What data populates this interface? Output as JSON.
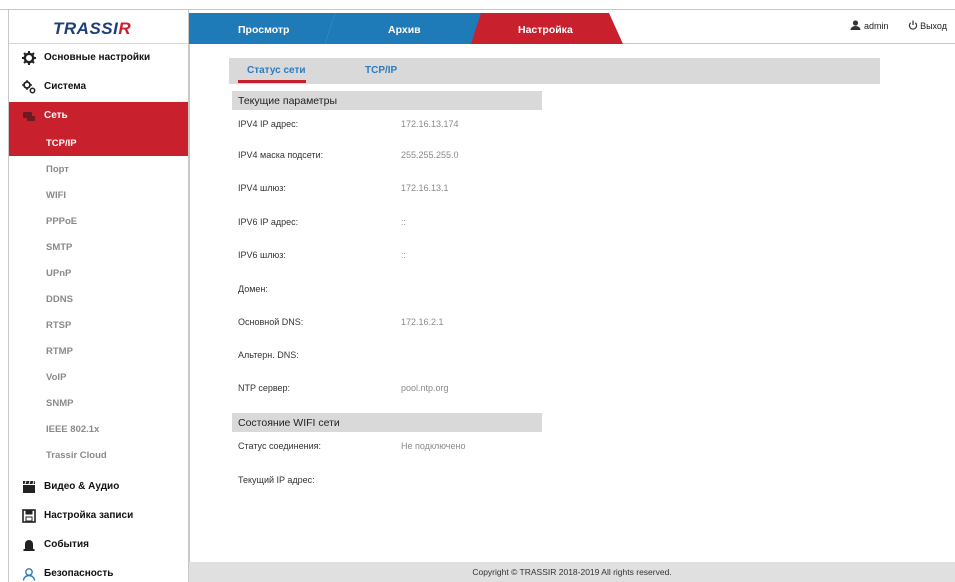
{
  "brand": {
    "logo_main": "TRASSI",
    "logo_accent": "R"
  },
  "topnav": {
    "tabs": [
      {
        "label": "Просмотр",
        "color": "#1f7ab8"
      },
      {
        "label": "Архив",
        "color": "#1f7ab8"
      },
      {
        "label": "Настройка",
        "color": "#c8202c"
      }
    ],
    "user_label": "admin",
    "logout_label": "Выход"
  },
  "sidebar": {
    "items": [
      {
        "label": "Основные настройки",
        "icon": "gear-icon"
      },
      {
        "label": "Система",
        "icon": "gears-icon"
      },
      {
        "label": "Сеть",
        "icon": "network-icon"
      },
      {
        "label": "Видео & Аудио",
        "icon": "clapperboard-icon"
      },
      {
        "label": "Настройка записи",
        "icon": "floppy-icon"
      },
      {
        "label": "События",
        "icon": "alarm-icon"
      },
      {
        "label": "Безопасность",
        "icon": "user-icon"
      }
    ],
    "network_sub": [
      "TCP/IP",
      "Порт",
      "WIFI",
      "PPPoE",
      "SMTP",
      "UPnP",
      "DDNS",
      "RTSP",
      "RTMP",
      "VoIP",
      "SNMP",
      "IEEE 802.1x",
      "Trassir Cloud"
    ]
  },
  "subtabs": [
    "Статус сети",
    "TCP/IP"
  ],
  "status": {
    "current_header": "Текущие параметры",
    "params": [
      {
        "label": "IPV4 IP адрес:",
        "value": "172.16.13.174"
      },
      {
        "label": "IPV4 маска подсети:",
        "value": "255.255.255.0"
      },
      {
        "label": "IPV4 шлюз:",
        "value": "172.16.13.1"
      },
      {
        "label": "IPV6 IP адрес:",
        "value": "::"
      },
      {
        "label": "IPV6 шлюз:",
        "value": "::"
      },
      {
        "label": "Домен:",
        "value": ""
      },
      {
        "label": "Основной DNS:",
        "value": "172.16.2.1"
      },
      {
        "label": "Альтерн. DNS:",
        "value": ""
      },
      {
        "label": "NTP сервер:",
        "value": "pool.ntp.org"
      }
    ],
    "wifi_header": "Состояние WIFI сети",
    "wifi": [
      {
        "label": "Статус соединения:",
        "value": "Не подключено"
      },
      {
        "label": "Текущий IP адрес:",
        "value": ""
      }
    ]
  },
  "footer": {
    "text": "Copyright © TRASSIR 2018-2019 All rights reserved."
  },
  "colors": {
    "accent_red": "#c8202c",
    "accent_blue": "#1f7ab8",
    "link_blue": "#2b7cbf",
    "panel_gray": "#d9d9d9"
  }
}
